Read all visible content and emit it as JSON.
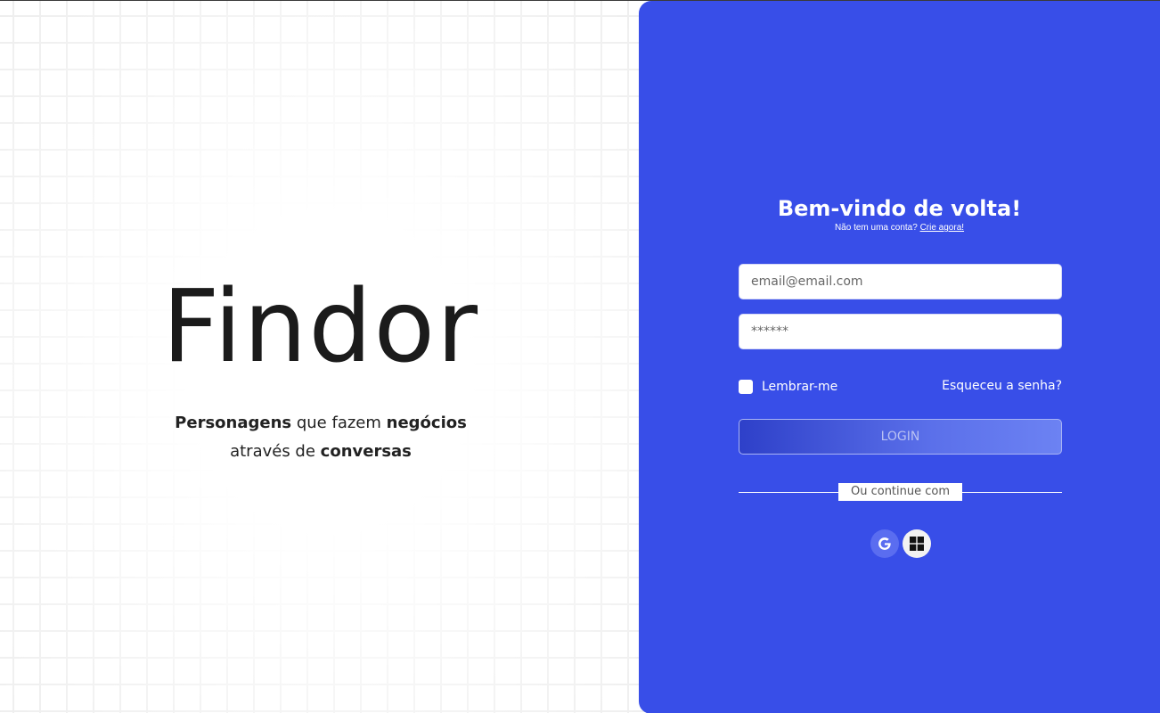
{
  "brand": {
    "title": "Findor",
    "tagline": {
      "part1": "Personagens",
      "part2": " que fazem ",
      "part3": "negócios",
      "part4": "através de ",
      "part5": "conversas"
    }
  },
  "login": {
    "title": "Bem-vindo de volta!",
    "no_account": "Não tem uma conta?",
    "create_link": "Crie agora!",
    "email_placeholder": "email@email.com",
    "password_placeholder": "******",
    "remember_label": "Lembrar-me",
    "forgot_label": "Esqueceu a senha?",
    "login_button": "LOGIN",
    "divider_text": "Ou continue com",
    "social": [
      "google-icon",
      "windows-icon"
    ]
  },
  "colors": {
    "panel_bg": "#384ee8",
    "text_dark": "#1b1b1b"
  }
}
